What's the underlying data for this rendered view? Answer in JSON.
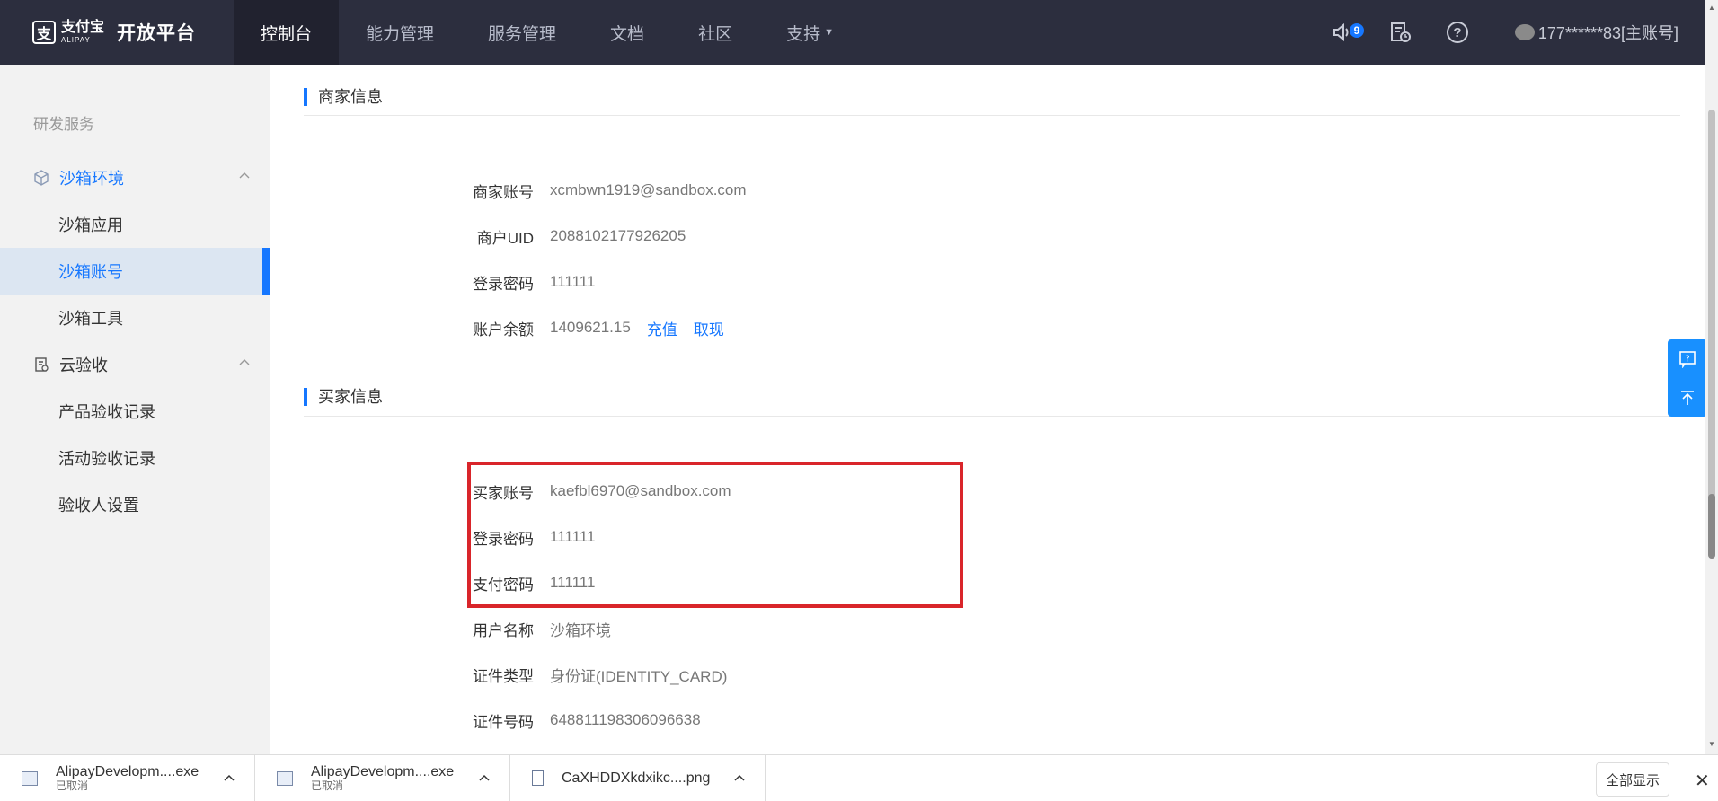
{
  "brand": {
    "logo_cn": "支付宝",
    "logo_en": "ALIPAY",
    "platform": "开放平台"
  },
  "nav": {
    "items": [
      {
        "label": "控制台"
      },
      {
        "label": "能力管理"
      },
      {
        "label": "服务管理"
      },
      {
        "label": "文档"
      },
      {
        "label": "社区"
      },
      {
        "label": "支持"
      }
    ],
    "notification_count": "9",
    "account": "177******83[主账号]"
  },
  "sidebar": {
    "section": "研发服务",
    "groups": [
      {
        "label": "沙箱环境",
        "items": [
          {
            "label": "沙箱应用"
          },
          {
            "label": "沙箱账号"
          },
          {
            "label": "沙箱工具"
          }
        ]
      },
      {
        "label": "云验收",
        "items": [
          {
            "label": "产品验收记录"
          },
          {
            "label": "活动验收记录"
          },
          {
            "label": "验收人设置"
          }
        ]
      }
    ]
  },
  "merchant": {
    "title": "商家信息",
    "rows": [
      {
        "label": "商家账号",
        "value": "xcmbwn1919@sandbox.com"
      },
      {
        "label": "商户UID",
        "value": "2088102177926205"
      },
      {
        "label": "登录密码",
        "value": "111111"
      },
      {
        "label": "账户余额",
        "value": "1409621.15"
      }
    ],
    "recharge": "充值",
    "withdraw": "取现"
  },
  "buyer": {
    "title": "买家信息",
    "rows": [
      {
        "label": "买家账号",
        "value": "kaefbl6970@sandbox.com"
      },
      {
        "label": "登录密码",
        "value": "111111"
      },
      {
        "label": "支付密码",
        "value": "111111"
      },
      {
        "label": "用户名称",
        "value": "沙箱环境"
      },
      {
        "label": "证件类型",
        "value": "身份证(IDENTITY_CARD)"
      },
      {
        "label": "证件号码",
        "value": "648811198306096638"
      }
    ]
  },
  "downloads": {
    "items": [
      {
        "name": "AlipayDevelopm....exe",
        "status": "已取消"
      },
      {
        "name": "AlipayDevelopm....exe",
        "status": "已取消"
      },
      {
        "name": "CaXHDDXkdxikc....png",
        "status": ""
      }
    ],
    "show_all": "全部显示"
  },
  "colors": {
    "topbar": "#2c2e3e",
    "accent": "#1677ff",
    "highlight": "#d9252a"
  }
}
